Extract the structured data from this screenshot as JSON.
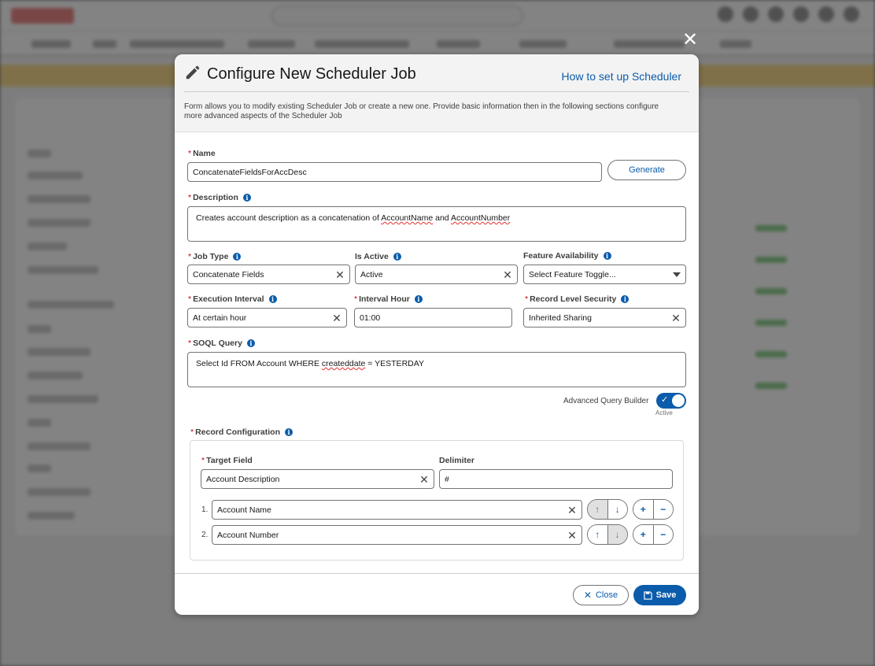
{
  "modal": {
    "title": "Configure New Scheduler Job",
    "help_link": "How to set up Scheduler",
    "description": "Form allows you to modify existing Scheduler Job or create a new one. Provide basic information then in the following sections configure more advanced aspects of the Scheduler Job"
  },
  "form": {
    "required_mark": "*",
    "name": {
      "label": "Name",
      "value": "ConcatenateFieldsForAccDesc",
      "generate_label": "Generate"
    },
    "description": {
      "label": "Description",
      "value_before": "Creates account description as a concatenation of ",
      "value_word1": "AccountName",
      "value_mid": " and ",
      "value_word2": "AccountNumber"
    },
    "job_type": {
      "label": "Job Type",
      "value": "Concatenate Fields"
    },
    "is_active": {
      "label": "Is Active",
      "value": "Active"
    },
    "feature_availability": {
      "label": "Feature Availability",
      "placeholder": "Select Feature Toggle..."
    },
    "execution_interval": {
      "label": "Execution Interval",
      "value": "At certain hour"
    },
    "interval_hour": {
      "label": "Interval Hour",
      "value": "01:00"
    },
    "record_level_security": {
      "label": "Record Level Security",
      "value": "Inherited Sharing"
    },
    "soql_query": {
      "label": "SOQL Query",
      "value_before": "Select Id FROM Account WHERE ",
      "value_word": "createddate",
      "value_after": " = YESTERDAY"
    },
    "advanced_query_builder": {
      "label": "Advanced Query Builder",
      "state": "Active"
    },
    "record_configuration": {
      "label": "Record Configuration",
      "target_field": {
        "label": "Target Field",
        "value": "Account Description"
      },
      "delimiter": {
        "label": "Delimiter",
        "value": "#"
      },
      "rows": [
        {
          "index": "1.",
          "value": "Account Name"
        },
        {
          "index": "2.",
          "value": "Account Number"
        }
      ]
    }
  },
  "footer": {
    "close_label": "Close",
    "save_label": "Save"
  },
  "colors": {
    "brand": "#0b5cab",
    "required": "#ba0517"
  }
}
